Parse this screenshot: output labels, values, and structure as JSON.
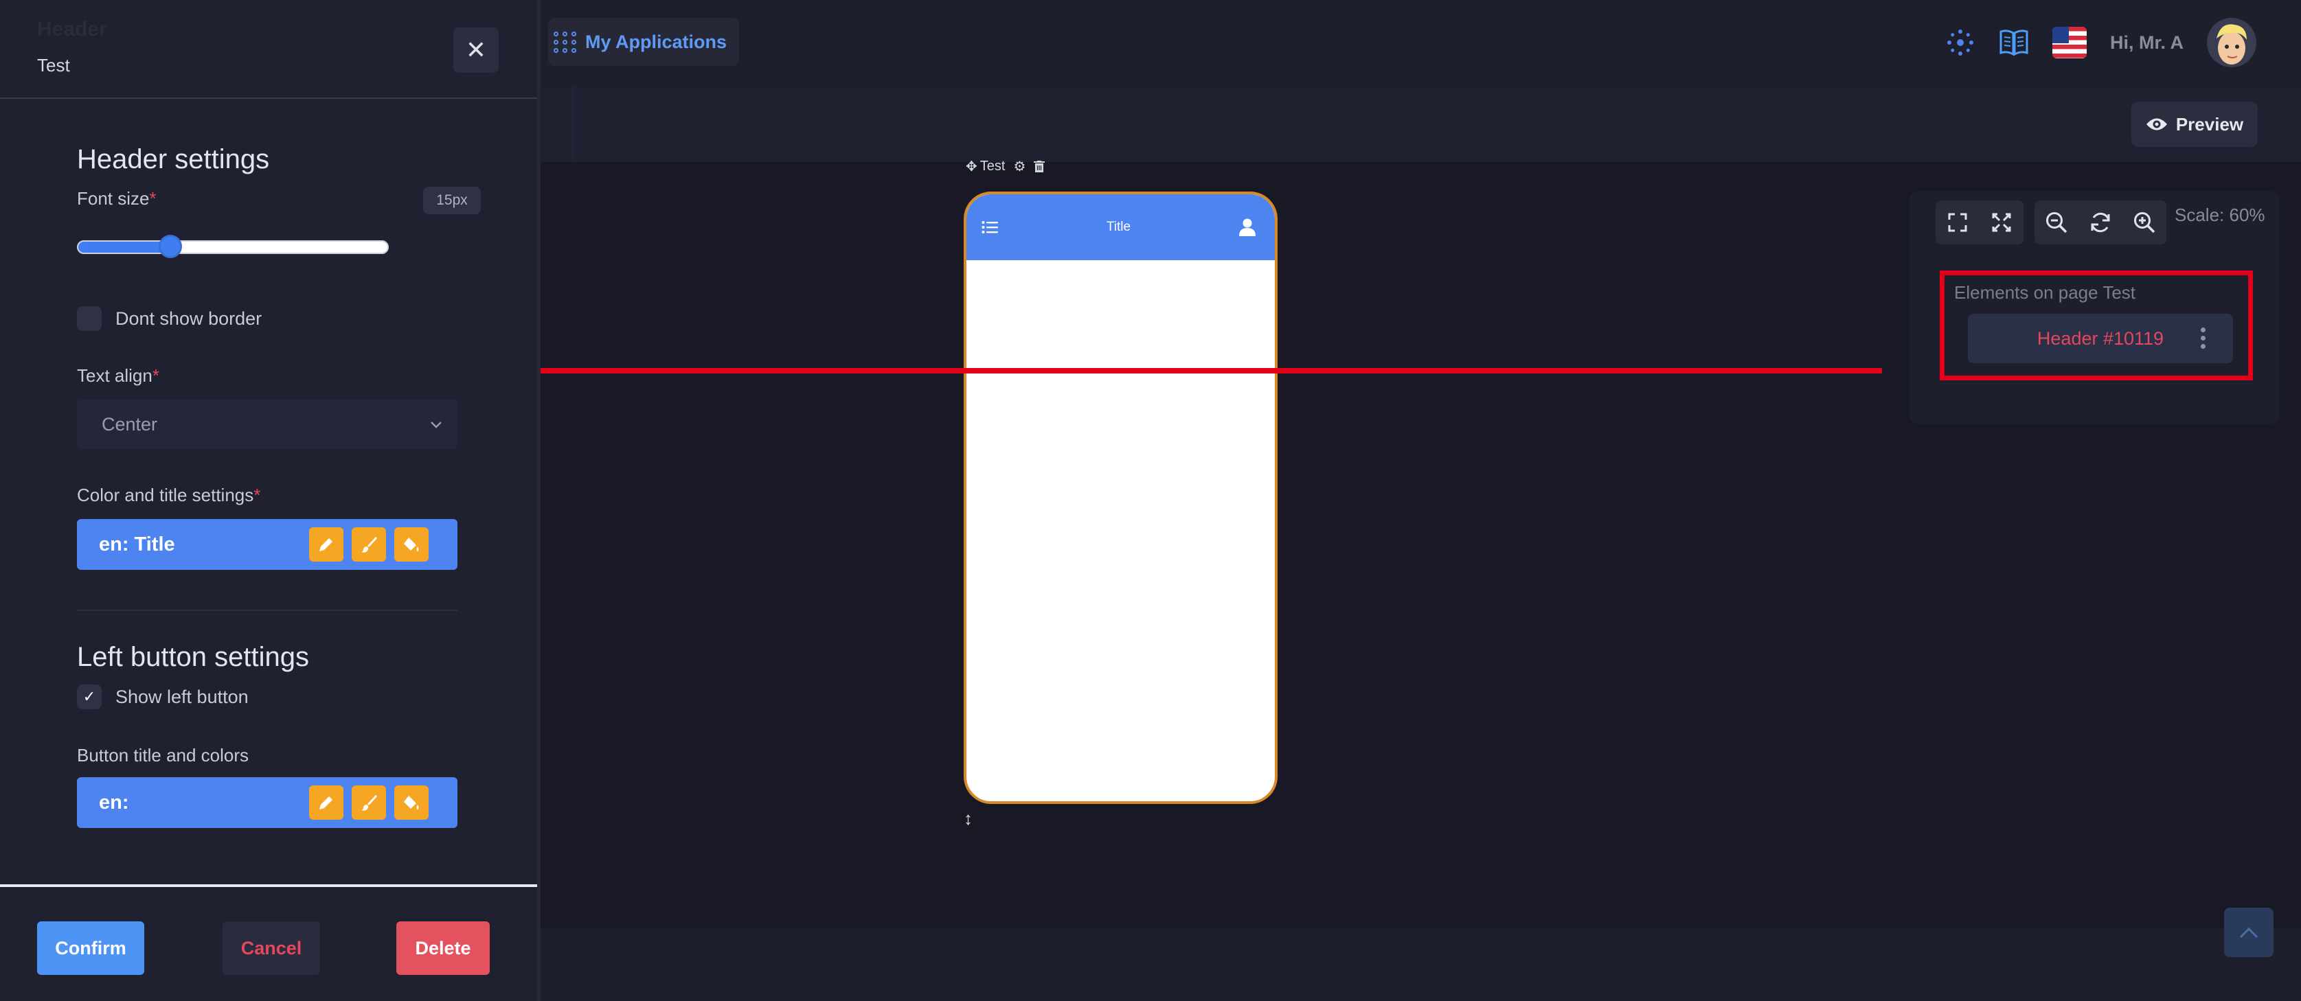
{
  "topbar": {
    "apps_label": "My Applications",
    "greeting": "Hi, Mr. A",
    "icons": [
      "apps-grid-icon",
      "spinner-icon",
      "book-icon",
      "us-flag-icon",
      "avatar"
    ]
  },
  "toolbar": {
    "preview_label": "Preview"
  },
  "drawer": {
    "ghost_title": "Header",
    "subtitle": "Test",
    "header_settings": {
      "title": "Header settings",
      "font_size_label": "Font size",
      "font_size_value": "15px",
      "font_size_fraction": 0.3,
      "dont_show_border_label": "Dont show border",
      "dont_show_border_checked": false,
      "text_align_label": "Text align",
      "text_align_value": "Center",
      "color_title_label": "Color and title settings",
      "color_title_value": "en: Title"
    },
    "left_button_settings": {
      "title": "Left button settings",
      "show_left_button_label": "Show left button",
      "show_left_button_checked": true,
      "button_title_label": "Button title and colors",
      "button_title_value": "en:"
    },
    "required_mark": "*",
    "actions": {
      "confirm": "Confirm",
      "cancel": "Cancel",
      "delete": "Delete"
    }
  },
  "canvas": {
    "element_label": "Test",
    "phone_header_title": "Title"
  },
  "right_panel": {
    "scale_label": "Scale: 60%",
    "elements_title": "Elements on page Test",
    "elements": [
      {
        "label": "Header #10119"
      }
    ]
  },
  "colors": {
    "accent_blue": "#4d84f0",
    "danger_red": "#e4485a",
    "annotation_red": "#e2001a",
    "phone_border": "#d88a2b",
    "tool_orange": "#f5a623"
  }
}
